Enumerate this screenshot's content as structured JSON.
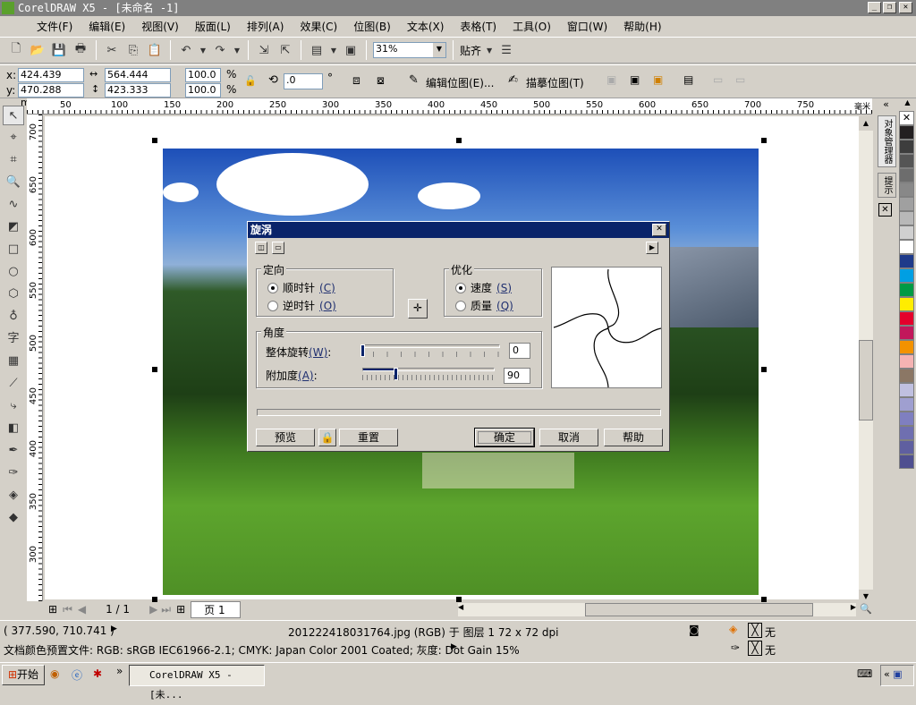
{
  "window": {
    "title": "CorelDRAW X5 - [未命名 -1]"
  },
  "menu": [
    "文件(F)",
    "编辑(E)",
    "视图(V)",
    "版面(L)",
    "排列(A)",
    "效果(C)",
    "位图(B)",
    "文本(X)",
    "表格(T)",
    "工具(O)",
    "窗口(W)",
    "帮助(H)"
  ],
  "toolbar": {
    "zoom": "31%",
    "snap": "贴齐"
  },
  "propbar": {
    "x_label": "x:",
    "x": "424.439 mm",
    "y_label": "y:",
    "y": "470.288 mm",
    "w": "564.444 mm",
    "h": "423.333 mm",
    "scale_x": "100.0",
    "scale_y": "100.0",
    "pct": "%",
    "rotation": ".0",
    "deg": "°",
    "edit_bitmap": "编辑位图(E)...",
    "trace_bitmap": "描摹位图(T)"
  },
  "ruler": {
    "top": [
      "50",
      "100",
      "150",
      "200",
      "250",
      "300",
      "350",
      "400",
      "450",
      "500",
      "550",
      "600",
      "650",
      "700",
      "750"
    ],
    "unit": "毫米",
    "left": [
      "700",
      "650",
      "600",
      "550",
      "500",
      "450",
      "400",
      "350",
      "300"
    ]
  },
  "toolbox": {
    "text_tool": "字"
  },
  "docker": {
    "tab1": "对象管理器",
    "tab2": "提示"
  },
  "palette": [
    "#231f20",
    "#3d3d3d",
    "#555",
    "#6d6d6d",
    "#888",
    "#a0a0a0",
    "#b8b8b8",
    "#d0d0d0",
    "#ffffff",
    "#1e3a8a",
    "#009fe3",
    "#009a44",
    "#ffed00",
    "#e4002b",
    "#c2185b",
    "#f39200",
    "#f5b3b3",
    "#8b7765",
    "#c0c0e0",
    "#9f9fd0",
    "#7f7fc0",
    "#6f6fb0",
    "#5f5fa0",
    "#4f4f90"
  ],
  "dialog": {
    "title": "旋涡",
    "orientation": {
      "label": "定向",
      "clockwise": "顺时针",
      "clockwise_key": "(C)",
      "counter": "逆时针",
      "counter_key": "(O)",
      "selected": "clockwise"
    },
    "optimize": {
      "label": "优化",
      "speed": "速度",
      "speed_key": "(S)",
      "quality": "质量",
      "quality_key": "(Q)",
      "selected": "speed"
    },
    "angle": {
      "label": "角度",
      "whole": "整体旋转",
      "whole_key": "(W)",
      "whole_value": "0",
      "additional": "附加度",
      "additional_key": "(A)",
      "additional_value": "90",
      "colon": ":"
    },
    "buttons": {
      "preview": "预览",
      "reset": "重置",
      "ok": "确定",
      "cancel": "取消",
      "help": "帮助"
    }
  },
  "pagenav": {
    "page_count": "1 / 1",
    "tab": "页 1"
  },
  "status": {
    "coords": "( 377.590, 710.741 )",
    "object": "201222418031764.jpg (RGB) 于 图层 1 72 x 72 dpi",
    "profile": "文档颜色预置文件: RGB: sRGB IEC61966-2.1; CMYK: Japan Color 2001 Coated; 灰度: Dot Gain 15%",
    "fill": "无",
    "outline": "无"
  },
  "taskbar": {
    "start": "开始",
    "task": "CorelDRAW X5 - [未..."
  }
}
